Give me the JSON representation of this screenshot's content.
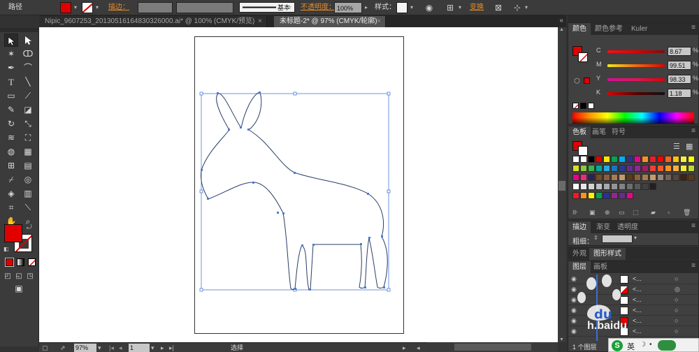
{
  "control_bar": {
    "selection_label": "路径",
    "stroke_label": "描边：",
    "stroke_style_label": "基本",
    "opacity_label": "不透明度：",
    "opacity_value": "100%",
    "style_label": "样式：",
    "transform_label": "变换",
    "fill_color": "#e00000"
  },
  "tabs": [
    {
      "label": "Nipic_9607253_20130516164830326000.ai* @ 100% (CMYK/预览)"
    },
    {
      "label": "未标题-2* @ 97% (CMYK/轮廓)"
    }
  ],
  "status_bar": {
    "zoom": "97%",
    "page": "1",
    "tool_name": "选择"
  },
  "color_panel": {
    "tabs": [
      "颜色",
      "颜色参考",
      "Kuler"
    ],
    "c_label": "C",
    "c_value": "8.67",
    "m_label": "M",
    "m_value": "99.51",
    "y_label": "Y",
    "y_value": "98.33",
    "k_label": "K",
    "k_value": "1.18",
    "pct": "%"
  },
  "swatch_panel": {
    "tabs": [
      "色板",
      "画笔",
      "符号"
    ]
  },
  "stroke_panel": {
    "tabs": [
      "描边",
      "渐变",
      "透明度"
    ],
    "weight_label": "粗细："
  },
  "appearance_panel": {
    "tabs": [
      "外观",
      "图形样式"
    ]
  },
  "layers_panel": {
    "tabs": [
      "图层",
      "画板"
    ],
    "rows": [
      {
        "name": "<..."
      },
      {
        "name": "<..."
      },
      {
        "name": "<..."
      },
      {
        "name": "<..."
      },
      {
        "name": "<..."
      },
      {
        "name": "<..."
      }
    ],
    "footer": "1 个图层"
  },
  "colors": {
    "accent_orange": "#e78c2d",
    "fill_red": "#e00000",
    "selection_blue": "#4a7bd6"
  },
  "watermark": {
    "brand": "Baidu",
    "text": "h.baidu"
  }
}
